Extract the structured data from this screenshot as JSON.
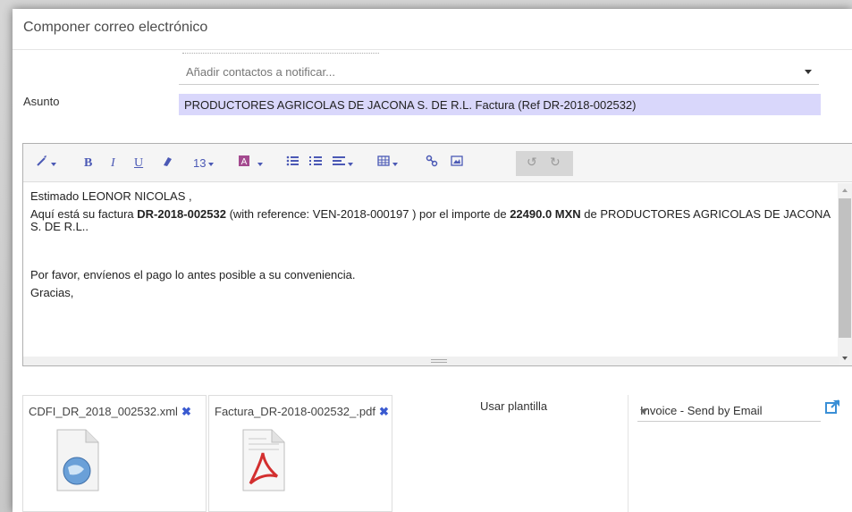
{
  "dialog": {
    "title": "Componer correo electrónico"
  },
  "contacts": {
    "placeholder": "Añadir contactos a notificar..."
  },
  "subject": {
    "label": "Asunto",
    "value": "PRODUCTORES AGRICOLAS DE JACONA S. DE R.L. Factura (Ref DR-2018-002532)"
  },
  "toolbar": {
    "font_size": "13",
    "bold": "B",
    "italic": "I",
    "underline": "U"
  },
  "body": {
    "greeting": "Estimado LEONOR NICOLAS ,",
    "line1_prefix": "Aquí está su factura ",
    "invoice_ref": "DR-2018-002532",
    "line1_mid": " (with reference: VEN-2018-000197 ) por el importe de ",
    "amount": "22490.0 MXN",
    "line1_suffix": " de PRODUCTORES AGRICOLAS DE JACONA S. DE R.L..",
    "request": "Por favor, envíenos el pago lo antes posible a su conveniencia.",
    "closing": "Gracias,"
  },
  "attachments": [
    {
      "name": "CDFI_DR_2018_002532.xml",
      "icon": "xml-file-icon"
    },
    {
      "name": "Factura_DR-2018-002532_.pdf",
      "icon": "pdf-file-icon"
    }
  ],
  "template": {
    "label": "Usar plantilla",
    "selected": "Invoice - Send by Email"
  },
  "colors": {
    "accent": "#4b59b5",
    "subject_highlight": "#d9d7fb"
  }
}
